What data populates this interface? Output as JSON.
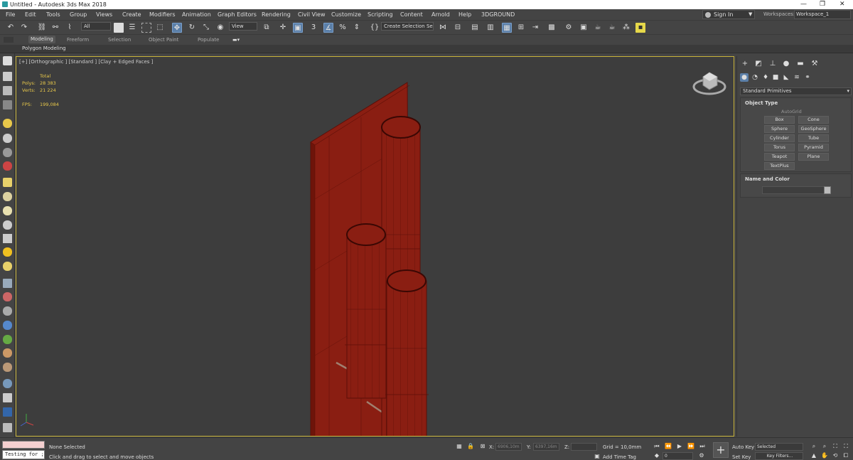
{
  "window": {
    "title": "Untitled - Autodesk 3ds Max 2018",
    "minimize": "—",
    "restore": "❐",
    "close": "✕"
  },
  "menu": [
    "File",
    "Edit",
    "Tools",
    "Group",
    "Views",
    "Create",
    "Modifiers",
    "Animation",
    "Graph Editors",
    "Rendering",
    "Civil View",
    "Customize",
    "Scripting",
    "Content",
    "Arnold",
    "Help",
    "3DGROUND"
  ],
  "account": {
    "sign_in": "Sign In",
    "workspaces_label": "Workspaces:",
    "workspace": "Workspace_1"
  },
  "toolbar": {
    "selection_filter": "All",
    "reference_coord": "View",
    "create_selection_set": "Create Selection Se"
  },
  "ribbon": {
    "tabs": [
      "Modeling",
      "Freeform",
      "Selection",
      "Object Paint",
      "Populate"
    ],
    "active_tab": "Modeling",
    "panel_label": "Polygon Modeling"
  },
  "viewport": {
    "label": "[+] [Orthographic ] [Standard ] [Clay + Edged Faces ]",
    "stats": {
      "total_label": "Total",
      "polys_label": "Polys:",
      "polys_value": "28 383",
      "verts_label": "Verts:",
      "verts_value": "21 224",
      "fps_label": "FPS:",
      "fps_value": "199,084"
    },
    "model_color": "#8a1e12",
    "wire_color": "#5c0f08"
  },
  "command_panel": {
    "category": "Standard Primitives",
    "object_type": {
      "title": "Object Type",
      "autogrid": "AutoGrid",
      "buttons": [
        "Box",
        "Cone",
        "Sphere",
        "GeoSphere",
        "Cylinder",
        "Tube",
        "Torus",
        "Pyramid",
        "Teapot",
        "Plane",
        "TextPlus"
      ]
    },
    "name_and_color": {
      "title": "Name and Color"
    }
  },
  "status": {
    "maxscript_input": "Testing for ;",
    "selection": "None Selected",
    "prompt": "Click and drag to select and move objects",
    "x_label": "X:",
    "x_value": "6906,10m",
    "y_label": "Y:",
    "y_value": "6397,16m",
    "z_label": "Z:",
    "grid": "Grid = 10,0mm",
    "add_time_tag": "Add Time Tag",
    "frame": "0",
    "auto_key": "Auto Key",
    "set_key": "Set Key",
    "key_filter": "Selected",
    "key_filters_btn": "Key Filters..."
  },
  "colors": {
    "accent": "#5b7fa8",
    "viewport_border": "#c8b33a",
    "stats": "#e8c84a"
  }
}
